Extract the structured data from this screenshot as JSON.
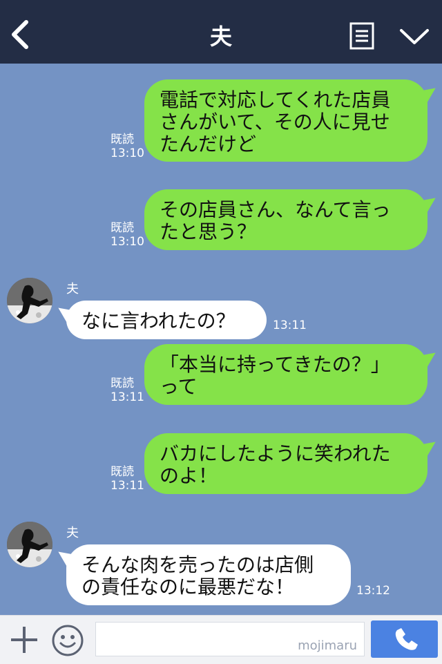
{
  "header": {
    "title": "夫",
    "back_icon": "chevron-left-icon",
    "menu_icon": "notes-icon",
    "more_icon": "chevron-down-icon"
  },
  "messages": [
    {
      "type": "out",
      "text_lines": [
        "電話で対応してくれた店員",
        "さんがいて、その人に見せ",
        "たんだけど"
      ],
      "read_label": "既読",
      "time": "13:10"
    },
    {
      "type": "out",
      "text_lines": [
        "その店員さん、なんて言っ",
        "たと思う？"
      ],
      "read_label": "既読",
      "time": "13:10"
    },
    {
      "type": "in",
      "sender": "夫",
      "text_lines": [
        "なに言われたの？"
      ],
      "time": "13:11"
    },
    {
      "type": "out",
      "text_lines": [
        "「本当に持ってきたの？」",
        "って"
      ],
      "read_label": "既読",
      "time": "13:11"
    },
    {
      "type": "out",
      "text_lines": [
        "バカにしたように笑われた",
        "のよ！"
      ],
      "read_label": "既読",
      "time": "13:11"
    },
    {
      "type": "in",
      "sender": "夫",
      "text_lines": [
        "そんな肉を売ったのは店側",
        "の責任なのに最悪だな！"
      ],
      "time": "13:12"
    }
  ],
  "footer": {
    "plus_icon": "plus-icon",
    "emoji_icon": "smiley-icon",
    "input_value": "",
    "watermark": "mojimaru",
    "call_icon": "phone-icon"
  },
  "colors": {
    "header_bg": "#232d45",
    "chat_bg": "#7493c4",
    "out_bubble": "#85e249",
    "in_bubble": "#ffffff",
    "call_button": "#4b82e2"
  }
}
